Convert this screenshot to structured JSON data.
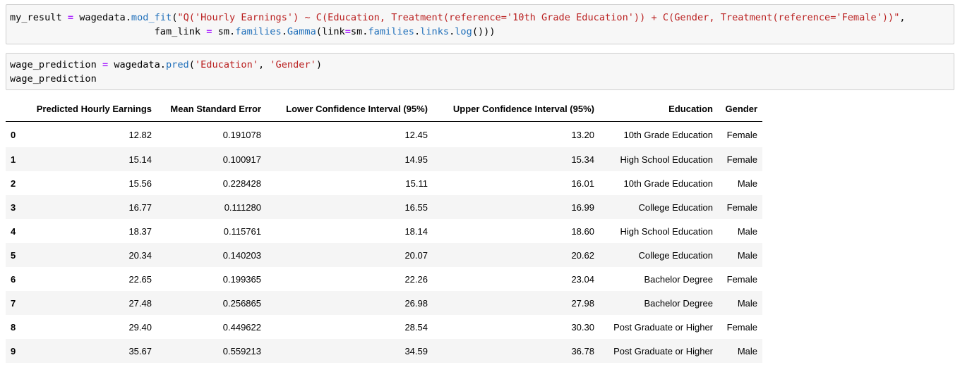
{
  "cells": [
    {
      "line1": {
        "a": "my_result",
        "b": " = ",
        "c": "wagedata.",
        "d": "mod_fit",
        "e": "(",
        "f": "\"Q('Hourly Earnings') ~ C(Education, Treatment(reference='10th Grade Education')) + C(Gender, Treatment(reference='Female'))\"",
        "g": ","
      },
      "line2": {
        "a": "                         fam_link ",
        "b": "=",
        "c": " sm.",
        "d": "families",
        "e": ".",
        "f": "Gamma",
        "g": "(link",
        "h": "=",
        "i": "sm.",
        "j": "families",
        "k": ".",
        "l": "links",
        "m": ".",
        "n": "log",
        "o": "()))"
      }
    },
    {
      "line1": {
        "a": "wage_prediction",
        "b": " = ",
        "c": "wagedata.",
        "d": "pred",
        "e": "(",
        "f": "'Education'",
        "g": ", ",
        "h": "'Gender'",
        "i": ")"
      },
      "line2": "wage_prediction"
    }
  ],
  "table": {
    "columns": [
      "",
      "Predicted Hourly Earnings",
      "Mean Standard Error",
      "Lower Confidence Interval (95%)",
      "Upper Confidence Interval (95%)",
      "Education",
      "Gender"
    ],
    "rows": [
      [
        "0",
        "12.82",
        "0.191078",
        "12.45",
        "13.20",
        "10th Grade Education",
        "Female"
      ],
      [
        "1",
        "15.14",
        "0.100917",
        "14.95",
        "15.34",
        "High School Education",
        "Female"
      ],
      [
        "2",
        "15.56",
        "0.228428",
        "15.11",
        "16.01",
        "10th Grade Education",
        "Male"
      ],
      [
        "3",
        "16.77",
        "0.111280",
        "16.55",
        "16.99",
        "College Education",
        "Female"
      ],
      [
        "4",
        "18.37",
        "0.115761",
        "18.14",
        "18.60",
        "High School Education",
        "Male"
      ],
      [
        "5",
        "20.34",
        "0.140203",
        "20.07",
        "20.62",
        "College Education",
        "Male"
      ],
      [
        "6",
        "22.65",
        "0.199365",
        "22.26",
        "23.04",
        "Bachelor Degree",
        "Female"
      ],
      [
        "7",
        "27.48",
        "0.256865",
        "26.98",
        "27.98",
        "Bachelor Degree",
        "Male"
      ],
      [
        "8",
        "29.40",
        "0.449622",
        "28.54",
        "30.30",
        "Post Graduate or Higher",
        "Female"
      ],
      [
        "9",
        "35.67",
        "0.559213",
        "34.59",
        "36.78",
        "Post Graduate or Higher",
        "Male"
      ]
    ]
  },
  "colors": {
    "cell_background": "#f7f7f7",
    "cell_border": "#cfcfcf",
    "operator": "#aa22ff",
    "string": "#ba2121",
    "function": "#1f6fba",
    "row_stripe": "#f5f5f5"
  }
}
